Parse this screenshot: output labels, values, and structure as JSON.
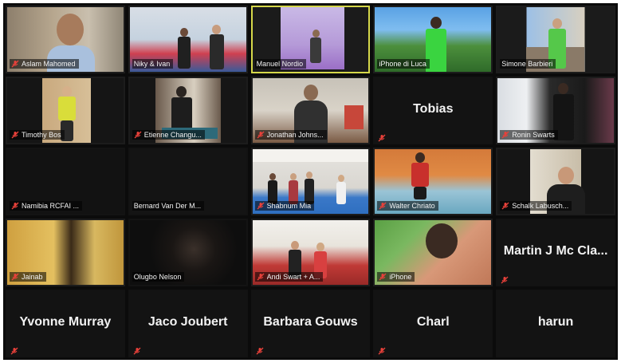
{
  "app": {
    "name": "Zoom gallery view"
  },
  "colors": {
    "active_border": "#d6d84a",
    "mute_red": "#e8413a",
    "tile_bg": "#1c1c1c"
  },
  "participants": [
    {
      "name": "Aslam Mahomed",
      "video": true
    },
    {
      "name": "Niky & Ivan",
      "video": true
    },
    {
      "name": "Manuel Nordio",
      "video": true,
      "active_speaker": true
    },
    {
      "name": "iPhone di Luca",
      "video": true
    },
    {
      "name": "Simone Barbieri",
      "video": true
    },
    {
      "name": "Timothy Bos",
      "video": true
    },
    {
      "name": "Etienne Changu...",
      "video": true
    },
    {
      "name": "Jonathan Johns...",
      "video": true
    },
    {
      "name": "Tobias",
      "video": false
    },
    {
      "name": "Ronin Swarts",
      "video": true
    },
    {
      "name": "Namibia RCFAI ...",
      "video": true
    },
    {
      "name": "Bernard Van Der M...",
      "video": true
    },
    {
      "name": "Shabnum Mia",
      "video": true
    },
    {
      "name": "Walter Chriato",
      "video": true
    },
    {
      "name": "Schalk Labusch...",
      "video": true
    },
    {
      "name": "Jainab",
      "video": true
    },
    {
      "name": "Olugbo Nelson",
      "video": true
    },
    {
      "name": "Andi Swart + A...",
      "video": true
    },
    {
      "name": "iPhone",
      "video": true
    },
    {
      "name": "Martin J Mc Cla...",
      "video": false
    },
    {
      "name": "Yvonne Murray",
      "video": false
    },
    {
      "name": "Jaco Joubert",
      "video": false
    },
    {
      "name": "Barbara Gouws",
      "video": false
    },
    {
      "name": "Charl",
      "video": false
    },
    {
      "name": "harun",
      "video": false
    }
  ]
}
